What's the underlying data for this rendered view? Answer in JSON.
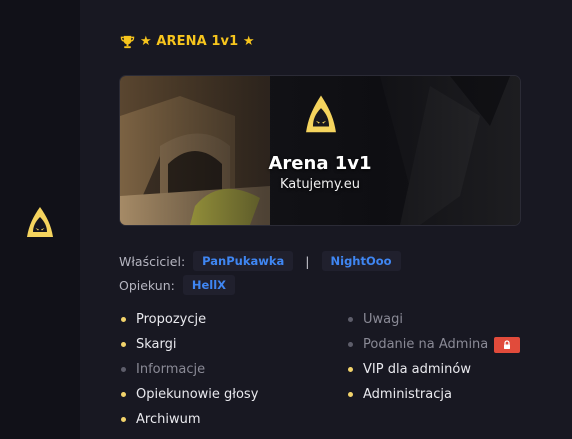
{
  "header": {
    "title": "★ ARENA 1v1 ★",
    "accent_color": "#f7c51d",
    "icon": "trophy-icon"
  },
  "banner": {
    "title": "Arena 1v1",
    "subtitle": "Katujemy.eu",
    "logo_icon": "hooded-figure-logo"
  },
  "owners": {
    "label": "Właściciel:",
    "names": [
      "PanPukawka",
      "NightOoo"
    ],
    "separator": "|"
  },
  "caretaker": {
    "label": "Opiekun:",
    "name": "HellX"
  },
  "menu_left": [
    {
      "label": "Propozycje",
      "active": true
    },
    {
      "label": "Skargi",
      "active": true
    },
    {
      "label": "Informacje",
      "active": false
    },
    {
      "label": "Opiekunowie głosy",
      "active": true
    },
    {
      "label": "Archiwum",
      "active": true
    }
  ],
  "menu_right": [
    {
      "label": "Uwagi",
      "active": false
    },
    {
      "label": "Podanie na Admina",
      "active": false,
      "locked": true
    },
    {
      "label": "VIP dla adminów",
      "active": true
    },
    {
      "label": "Administracja",
      "active": true
    }
  ],
  "colors": {
    "link": "#3f86f2",
    "bullet_active": "#f2d36b",
    "bullet_inactive": "#5d5d6a",
    "lock_badge": "#e14b3b"
  }
}
